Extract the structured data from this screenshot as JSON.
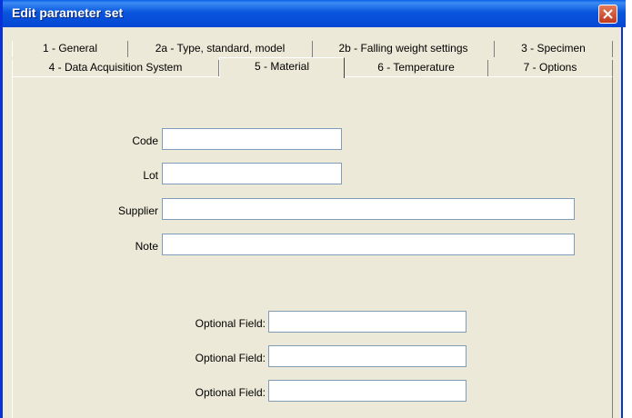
{
  "window": {
    "title": "Edit parameter set"
  },
  "tabs_top": [
    {
      "label": "1 - General"
    },
    {
      "label": "2a - Type, standard, model"
    },
    {
      "label": "2b - Falling weight settings"
    },
    {
      "label": "3 - Specimen"
    }
  ],
  "tabs_bottom": [
    {
      "label": "4 - Data Acquisition System"
    },
    {
      "label": "5 - Material",
      "active": true
    },
    {
      "label": "6 - Temperature"
    },
    {
      "label": "7 - Options"
    }
  ],
  "form": {
    "code_label": "Code",
    "code_value": "",
    "lot_label": "Lot",
    "lot_value": "",
    "supplier_label": "Supplier",
    "supplier_value": "",
    "note_label": "Note",
    "note_value": "",
    "optional": [
      {
        "label": "Optional Field:",
        "value": ""
      },
      {
        "label": "Optional Field:",
        "value": ""
      },
      {
        "label": "Optional Field:",
        "value": ""
      }
    ]
  }
}
